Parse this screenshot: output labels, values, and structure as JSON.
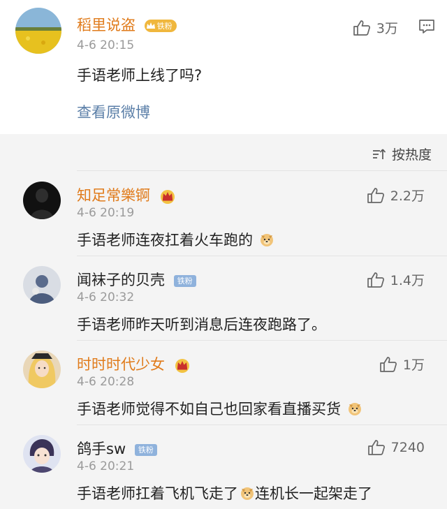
{
  "post": {
    "username": "稻里说盗",
    "fan_badge": "铁粉",
    "timestamp": "4-6 20:15",
    "text": "手语老师上线了吗?",
    "likes": "3万",
    "view_original": "查看原微博"
  },
  "sort_label": "按热度",
  "comments": [
    {
      "username": "知足常樂锕",
      "name_color": "#e07b1b",
      "badge": "crown",
      "timestamp": "4-6 20:19",
      "text": "手语老师连夜扛着火车跑的",
      "text_after_emoji": "",
      "emoji": true,
      "likes": "2.2万"
    },
    {
      "username": "闻袜子的贝壳",
      "name_color": "#222222",
      "badge": "铁粉",
      "timestamp": "4-6 20:32",
      "text": "手语老师昨天听到消息后连夜跑路了。",
      "text_after_emoji": "",
      "emoji": false,
      "likes": "1.4万"
    },
    {
      "username": "时时时代少女",
      "name_color": "#e07b1b",
      "badge": "crown",
      "timestamp": "4-6 20:28",
      "text": "手语老师觉得不如自己也回家看直播买货",
      "text_after_emoji": "",
      "emoji": true,
      "likes": "1万"
    },
    {
      "username": "鸽手sw",
      "name_color": "#222222",
      "badge": "铁粉",
      "timestamp": "4-6 20:21",
      "text": "手语老师扛着飞机飞走了",
      "text_after_emoji": "连机长一起架走了",
      "emoji": true,
      "likes": "7240"
    }
  ],
  "icons": {
    "like": "thumbs-up-icon",
    "reply": "comment-icon",
    "sort": "sort-icon",
    "crown": "crown-badge-icon",
    "emoji": "doge-emoji-icon"
  },
  "colors": {
    "orange_name": "#e07b1b",
    "link_blue": "#5b7fa8",
    "badge_gold": "#f0b73d",
    "badge_blue": "#8fb2dc"
  }
}
